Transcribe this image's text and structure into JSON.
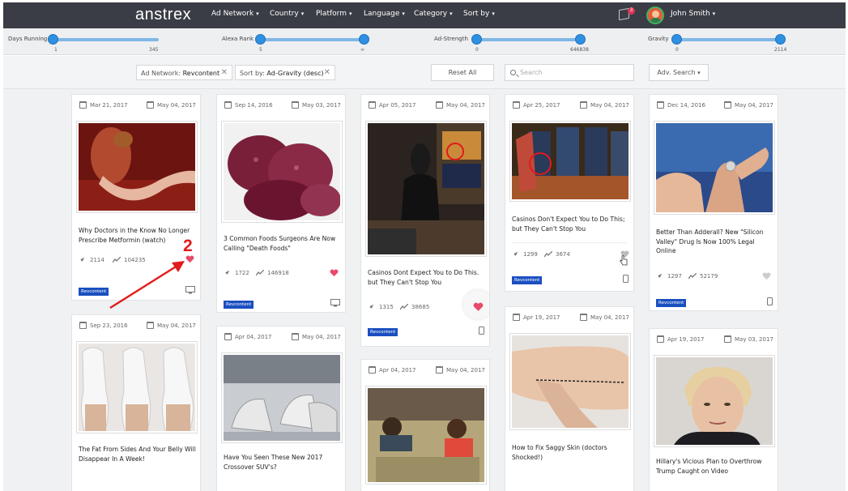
{
  "brand": {
    "logo": "anstrex"
  },
  "nav": {
    "items": [
      {
        "label": "Ad Network"
      },
      {
        "label": "Country"
      },
      {
        "label": "Platform"
      },
      {
        "label": "Language"
      },
      {
        "label": "Category"
      },
      {
        "label": "Sort by"
      }
    ],
    "notification_count": "3",
    "user_name": "John Smith"
  },
  "sliders": [
    {
      "label": "Days Running",
      "min": "1",
      "max": "345"
    },
    {
      "label": "Alexa Rank",
      "min": "5",
      "max": "∞"
    },
    {
      "label": "Ad-Strength",
      "min": "0",
      "max": "646838"
    },
    {
      "label": "Gravity",
      "min": "0",
      "max": "2114"
    }
  ],
  "filters": {
    "chips": [
      {
        "prefix": "Ad Network:",
        "value": "Revcontent"
      },
      {
        "prefix": "Sort by:",
        "value": "Ad-Gravity (desc)"
      }
    ],
    "reset_label": "Reset All",
    "search_placeholder": "Search",
    "adv_search_label": "Adv. Search"
  },
  "annotation": {
    "number": "2"
  },
  "cards": [
    {
      "first_seen": "Mar 21, 2017",
      "last_seen": "May 04, 2017",
      "title": "Why Doctors in the Know No Longer Prescribe Metformin (watch)",
      "strength": "2114",
      "gravity": "104235",
      "network": "Revcontent",
      "device": "desktop",
      "liked": true
    },
    {
      "first_seen": "Sep 14, 2016",
      "last_seen": "May 03, 2017",
      "title": "3 Common Foods Surgeons Are Now Calling \"Death Foods\"",
      "strength": "1722",
      "gravity": "146918",
      "network": "Revcontent",
      "device": "desktop",
      "liked": true
    },
    {
      "first_seen": "Apr 05, 2017",
      "last_seen": "May 04, 2017",
      "title": "Casinos Dont Expect You to Do This. but They Can't Stop You",
      "strength": "1315",
      "gravity": "38685",
      "network": "Revcontent",
      "device": "mobile",
      "liked": true
    },
    {
      "first_seen": "Apr 25, 2017",
      "last_seen": "May 04, 2017",
      "title": "Casinos Don't Expect You to Do This; but They Can't Stop You",
      "strength": "1299",
      "gravity": "3674",
      "network": "Revcontent",
      "device": "mobile",
      "liked": false
    },
    {
      "first_seen": "Dec 14, 2016",
      "last_seen": "May 04, 2017",
      "title": "Better Than Adderall? New \"Silicon Valley\" Drug Is Now 100% Legal Online",
      "strength": "1297",
      "gravity": "52179",
      "network": "Revcontent",
      "device": "mobile",
      "liked": false
    },
    {
      "first_seen": "Sep 23, 2016",
      "last_seen": "May 04, 2017",
      "title": "The Fat From Sides And Your Belly Will Disappear In A Week!"
    },
    {
      "first_seen": "Apr 04, 2017",
      "last_seen": "May 04, 2017",
      "title": "Have You Seen These New 2017 Crossover SUV's?"
    },
    {
      "first_seen": "Apr 04, 2017",
      "last_seen": "May 04, 2017",
      "title": ""
    },
    {
      "first_seen": "Apr 19, 2017",
      "last_seen": "May 04, 2017",
      "title": "How to Fix Saggy Skin (doctors Shocked!)"
    },
    {
      "first_seen": "Apr 19, 2017",
      "last_seen": "May 03, 2017",
      "title": "Hillary's Vicious Plan to Overthrow Trump Caught on Video"
    }
  ],
  "colors": {
    "nav_bg": "#3a3d45",
    "slider_knob": "#2f8fe0",
    "tag_bg": "#1a4fc0",
    "heart": "#e84a6a",
    "annotation": "#e21c1c"
  }
}
